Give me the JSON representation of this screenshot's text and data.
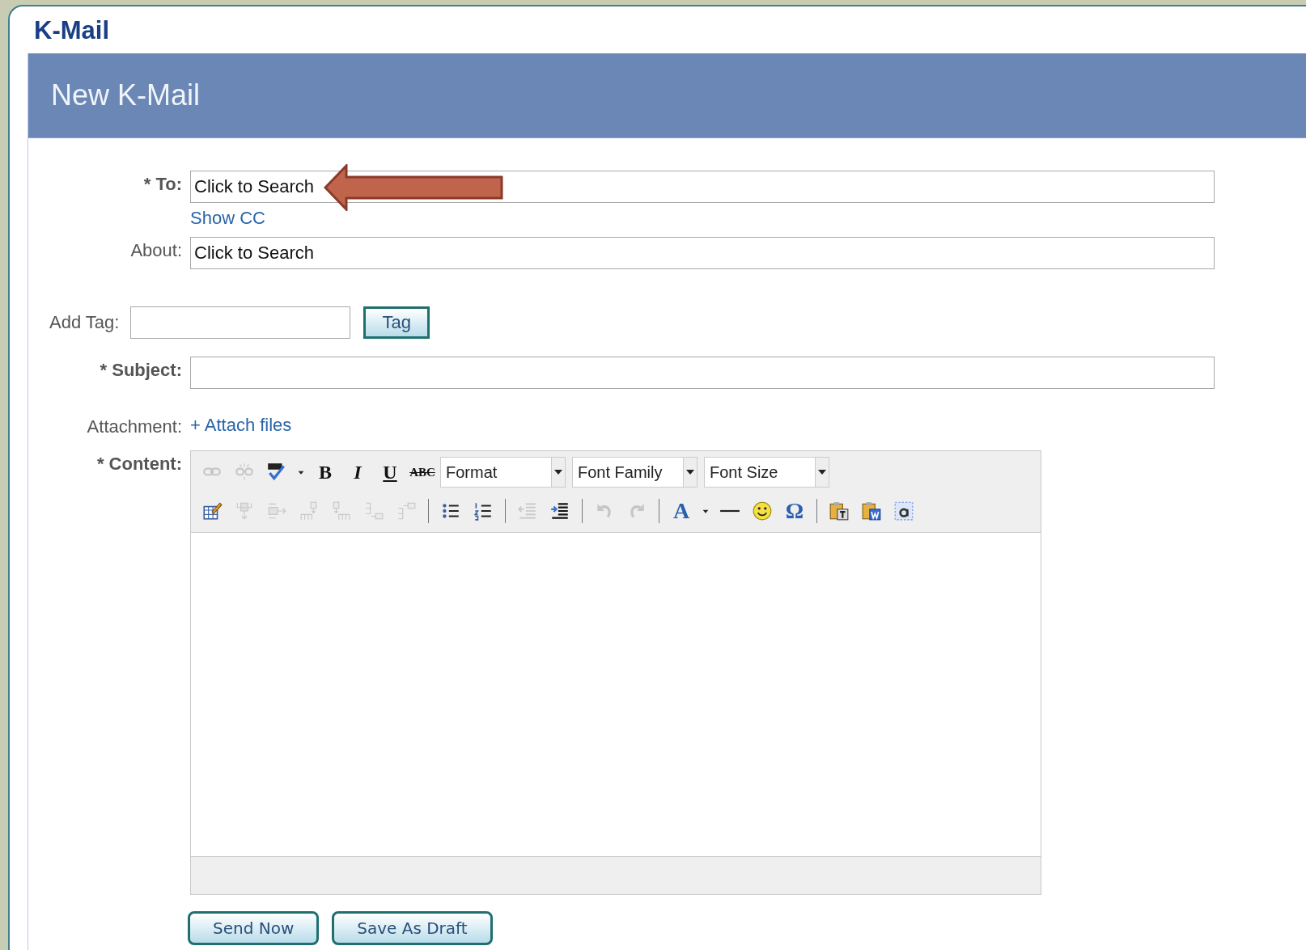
{
  "app": {
    "title": "K-Mail"
  },
  "header": {
    "title": "New K-Mail"
  },
  "to": {
    "label": "* To:",
    "required": true,
    "value": "Click to Search",
    "show_cc": "Show CC"
  },
  "about": {
    "label": "About:",
    "required": false,
    "value": "Click to Search"
  },
  "tag": {
    "label": "Add Tag:",
    "button": "Tag"
  },
  "subject": {
    "label": "* Subject:",
    "required": true
  },
  "attachment": {
    "label": "Attachment:",
    "link": "+ Attach files"
  },
  "content": {
    "label": "* Content:",
    "required": true
  },
  "toolbar": [
    [
      {
        "kind": "link",
        "disabled": true
      },
      {
        "kind": "unlink",
        "disabled": true
      },
      {
        "kind": "spellcheck",
        "disabled": false
      },
      {
        "kind": "caret",
        "disabled": false
      },
      {
        "kind": "bold",
        "text": "B",
        "disabled": false
      },
      {
        "kind": "italic",
        "text": "I",
        "disabled": false
      },
      {
        "kind": "underline",
        "text": "U",
        "disabled": false
      },
      {
        "kind": "strike",
        "text": "ABC",
        "disabled": false
      },
      {
        "kind": "select",
        "text": "Format"
      },
      {
        "kind": "select",
        "text": "Font Family"
      },
      {
        "kind": "select",
        "text": "Font Size"
      }
    ],
    [
      {
        "kind": "table",
        "disabled": false
      },
      {
        "kind": "colinsert",
        "disabled": true
      },
      {
        "kind": "rowinsert",
        "disabled": true
      },
      {
        "kind": "cellup",
        "disabled": true
      },
      {
        "kind": "celldown",
        "disabled": true
      },
      {
        "kind": "rowbelow",
        "disabled": true
      },
      {
        "kind": "rowabove",
        "disabled": true
      },
      {
        "kind": "separator"
      },
      {
        "kind": "bullets",
        "disabled": false
      },
      {
        "kind": "numbers",
        "disabled": false
      },
      {
        "kind": "separator"
      },
      {
        "kind": "outdent",
        "disabled": true
      },
      {
        "kind": "indent",
        "disabled": false
      },
      {
        "kind": "separator"
      },
      {
        "kind": "undo",
        "disabled": true
      },
      {
        "kind": "redo",
        "disabled": true
      },
      {
        "kind": "separator"
      },
      {
        "kind": "color",
        "text": "A",
        "disabled": false
      },
      {
        "kind": "caret",
        "disabled": false
      },
      {
        "kind": "rule",
        "disabled": false
      },
      {
        "kind": "smiley",
        "disabled": false
      },
      {
        "kind": "symbol",
        "text": "Ω",
        "disabled": false
      },
      {
        "kind": "separator"
      },
      {
        "kind": "pastetext",
        "disabled": false
      },
      {
        "kind": "pasteword",
        "disabled": false
      },
      {
        "kind": "selectall",
        "disabled": false
      }
    ]
  ],
  "buttons": [
    "Send Now",
    "Save As Draft"
  ]
}
